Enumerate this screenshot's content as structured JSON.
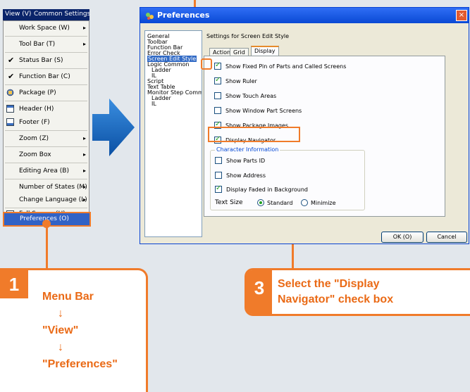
{
  "menu": {
    "bar": {
      "view": "View (V)",
      "common": "Common Settings"
    },
    "items": [
      {
        "label": "Work Space (W)",
        "arrow": "▸"
      },
      {
        "label": "Tool Bar (T)",
        "arrow": "▸"
      },
      {
        "label": "Status Bar (S)",
        "check": "✔"
      },
      {
        "label": "Function Bar (C)",
        "check": "✔"
      },
      {
        "label": "Package (P)"
      },
      {
        "label": "Header (H)"
      },
      {
        "label": "Footer (F)"
      },
      {
        "label": "Zoom (Z)",
        "arrow": "▸"
      },
      {
        "label": "Zoom Box",
        "arrow": "▸"
      },
      {
        "label": "Editing Area (B)",
        "arrow": "▸"
      },
      {
        "label": "Number of States (M)",
        "arrow": "▸"
      },
      {
        "label": "Change Language (L)",
        "arrow": "▸"
      },
      {
        "label": "Full Screen (U)"
      },
      {
        "label": "Preferences (O)"
      }
    ]
  },
  "dialog": {
    "title": "Preferences",
    "close": "×",
    "tree": [
      {
        "label": "General"
      },
      {
        "label": "Toolbar"
      },
      {
        "label": "Function Bar"
      },
      {
        "label": "Error Check"
      },
      {
        "label": "Screen Edit Style"
      },
      {
        "label": "Logic Common"
      },
      {
        "label": "Ladder"
      },
      {
        "label": "IL"
      },
      {
        "label": "Script"
      },
      {
        "label": "Text Table"
      },
      {
        "label": "Monitor Step Common"
      },
      {
        "label": "Ladder"
      },
      {
        "label": "IL"
      }
    ],
    "settings_title": "Settings for Screen Edit Style",
    "tabs": [
      "Action",
      "Grid",
      "Display"
    ],
    "checkboxes": [
      {
        "label": "Show Fixed Pin of Parts and Called Screens",
        "checked": true
      },
      {
        "label": "Show Ruler",
        "checked": true
      },
      {
        "label": "Show Touch Areas",
        "checked": false
      },
      {
        "label": "Show Window Part Screens",
        "checked": false
      },
      {
        "label": "Show Package Images",
        "checked": true
      },
      {
        "label": "Display Navigator",
        "checked": true
      }
    ],
    "char_info": {
      "legend": "Character Information",
      "items": [
        {
          "label": "Show Parts ID",
          "checked": false
        },
        {
          "label": "Show Address",
          "checked": false
        },
        {
          "label": "Display Faded in Background",
          "checked": true
        }
      ],
      "text_size_label": "Text Size",
      "options": [
        {
          "label": "Standard",
          "selected": true
        },
        {
          "label": "Minimize",
          "selected": false
        }
      ]
    },
    "ok": "OK (O)",
    "cancel": "Cancel"
  },
  "callouts": {
    "step1": {
      "num": "1",
      "lines": [
        "Menu Bar",
        "↓",
        "\"View\"",
        "↓",
        "\"Preferences\""
      ]
    },
    "step3": {
      "num": "3",
      "lines": [
        "Select the \"Display",
        "Navigator\" check box"
      ]
    }
  },
  "colors": {
    "accent": "#f07b2a",
    "menu_highlight": "#0a246a",
    "arrow_blue": "#1a6cc0"
  }
}
